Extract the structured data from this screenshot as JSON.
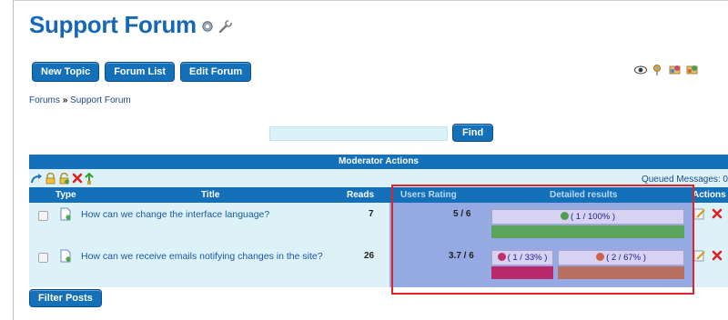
{
  "page": {
    "title": "Support Forum"
  },
  "title_icons": [
    "help-icon",
    "wrench-icon"
  ],
  "toolbar": {
    "buttons": [
      "New Topic",
      "Forum List",
      "Edit Forum"
    ]
  },
  "top_right_icons": [
    "watch-eye-icon",
    "user-pin-icon",
    "subscribe-icon",
    "rss-group-icon"
  ],
  "breadcrumb": {
    "root": "Forums",
    "separator": "»",
    "current": "Support Forum"
  },
  "search": {
    "value": "",
    "placeholder": "",
    "button": "Find"
  },
  "moderator": {
    "bar_label": "Moderator Actions",
    "tool_icons": [
      "move-arrow-icon",
      "lock-icon",
      "unlock-icon",
      "delete-x-icon",
      "archive-icon"
    ],
    "queued_messages": "Queued Messages: 0"
  },
  "table": {
    "headers": {
      "type": "Type",
      "title": "Title",
      "reads": "Reads",
      "users_rating": "Users Rating",
      "detailed_results": "Detailed results",
      "actions": "Actions"
    },
    "rows": [
      {
        "title": "How can we change the interface language?",
        "reads": "7",
        "rating": "5 / 6",
        "results": [
          {
            "label": "( 1 / 100% )",
            "fraction": 1.0,
            "face_color": "#4f9f4f",
            "bar_color": "#5aa55a"
          }
        ]
      },
      {
        "title": "How can we receive emails notifying changes in the site?",
        "reads": "26",
        "rating": "3.7 / 6",
        "results": [
          {
            "label": "( 1 / 33% )",
            "fraction": 0.33,
            "face_color": "#c0306a",
            "bar_color": "#b8286a"
          },
          {
            "label": "( 2 / 67% )",
            "fraction": 0.67,
            "face_color": "#d0604a",
            "bar_color": "#b87060"
          }
        ]
      }
    ]
  },
  "footer": {
    "filter_button": "Filter Posts"
  },
  "colors": {
    "brand_blue": "#1470b8",
    "title_blue": "#1468b5",
    "table_bg": "#ddf2f8",
    "highlight_red": "#e0242c"
  }
}
